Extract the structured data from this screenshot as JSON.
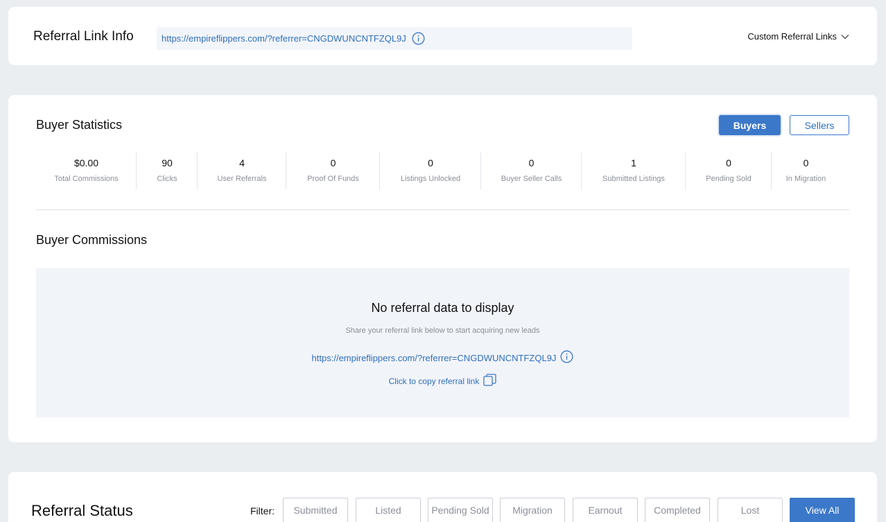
{
  "referral_link_info": {
    "title": "Referral Link Info",
    "link": "https://empireflippers.com/?referrer=CNGDWUNCNTFZQL9J",
    "info_icon": "info-icon",
    "custom_links_label": "Custom Referral Links"
  },
  "buyer_statistics": {
    "title": "Buyer Statistics",
    "toggle": {
      "buyers": "Buyers",
      "sellers": "Sellers",
      "selected": "Buyers"
    },
    "stats": [
      {
        "value": "$0.00",
        "label": "Total Commissions"
      },
      {
        "value": "90",
        "label": "Clicks"
      },
      {
        "value": "4",
        "label": "User Referrals"
      },
      {
        "value": "0",
        "label": "Proof Of Funds"
      },
      {
        "value": "0",
        "label": "Listings Unlocked"
      },
      {
        "value": "0",
        "label": "Buyer Seller Calls"
      },
      {
        "value": "1",
        "label": "Submitted Listings"
      },
      {
        "value": "0",
        "label": "Pending Sold"
      },
      {
        "value": "0",
        "label": "In Migration"
      }
    ]
  },
  "buyer_commissions": {
    "title": "Buyer Commissions",
    "empty_state": {
      "heading": "No referral data to display",
      "description": "Share your referral link below to start acquiring new leads",
      "link": "https://empireflippers.com/?referrer=CNGDWUNCNTFZQL9J",
      "copy_label": "Click to copy referral link"
    }
  },
  "referral_status": {
    "title": "Referral Status",
    "filter_label": "Filter:",
    "filters": [
      "Submitted",
      "Listed",
      "Pending Sold",
      "Migration",
      "Earnout",
      "Completed",
      "Lost",
      "View All"
    ],
    "active_filter": "View All"
  },
  "colors": {
    "accent": "#3c78c9",
    "link": "#2f6fbf",
    "page_bg": "#ebeef1",
    "muted": "#8a8f98"
  }
}
